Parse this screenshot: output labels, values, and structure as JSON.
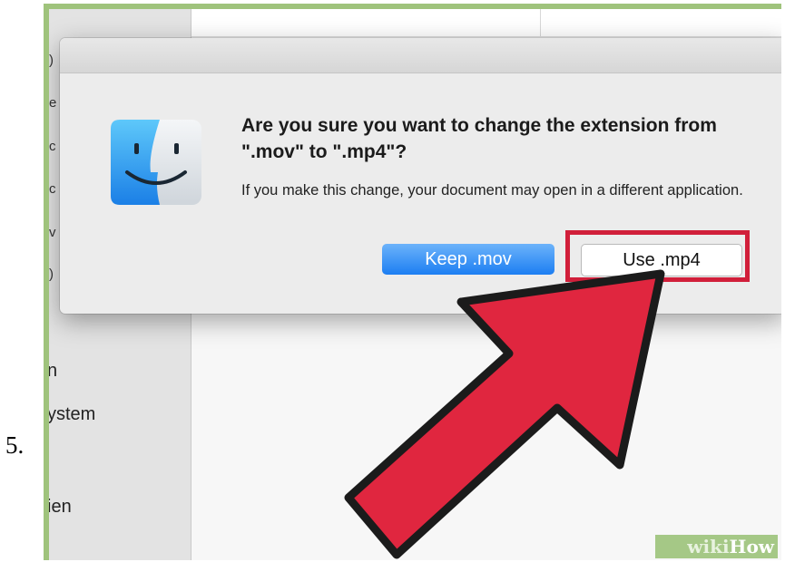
{
  "step": {
    "number": "5."
  },
  "sidebar": {
    "items": [
      {
        "label": "n"
      },
      {
        "label": "ystem"
      },
      {
        "label": "ien"
      }
    ],
    "glyphs": [
      ")",
      "e",
      "c",
      "c",
      "v",
      ")"
    ]
  },
  "dialog": {
    "title": "Are you sure you want to change the extension from \".mov\" to \".mp4\"?",
    "message": "If you make this change, your document may open in a different application.",
    "buttons": {
      "keep": "Keep .mov",
      "use": "Use .mp4"
    },
    "icon": "finder-icon"
  },
  "annotation": {
    "highlight_color": "#d11f3a",
    "arrow_color": "#e0263f",
    "arrow_icon": "red-arrow-icon"
  },
  "watermark": {
    "wiki": "wiki",
    "how": "How"
  },
  "colors": {
    "frame_border": "#9fc37c",
    "primary_button": "#1c7ef2"
  }
}
